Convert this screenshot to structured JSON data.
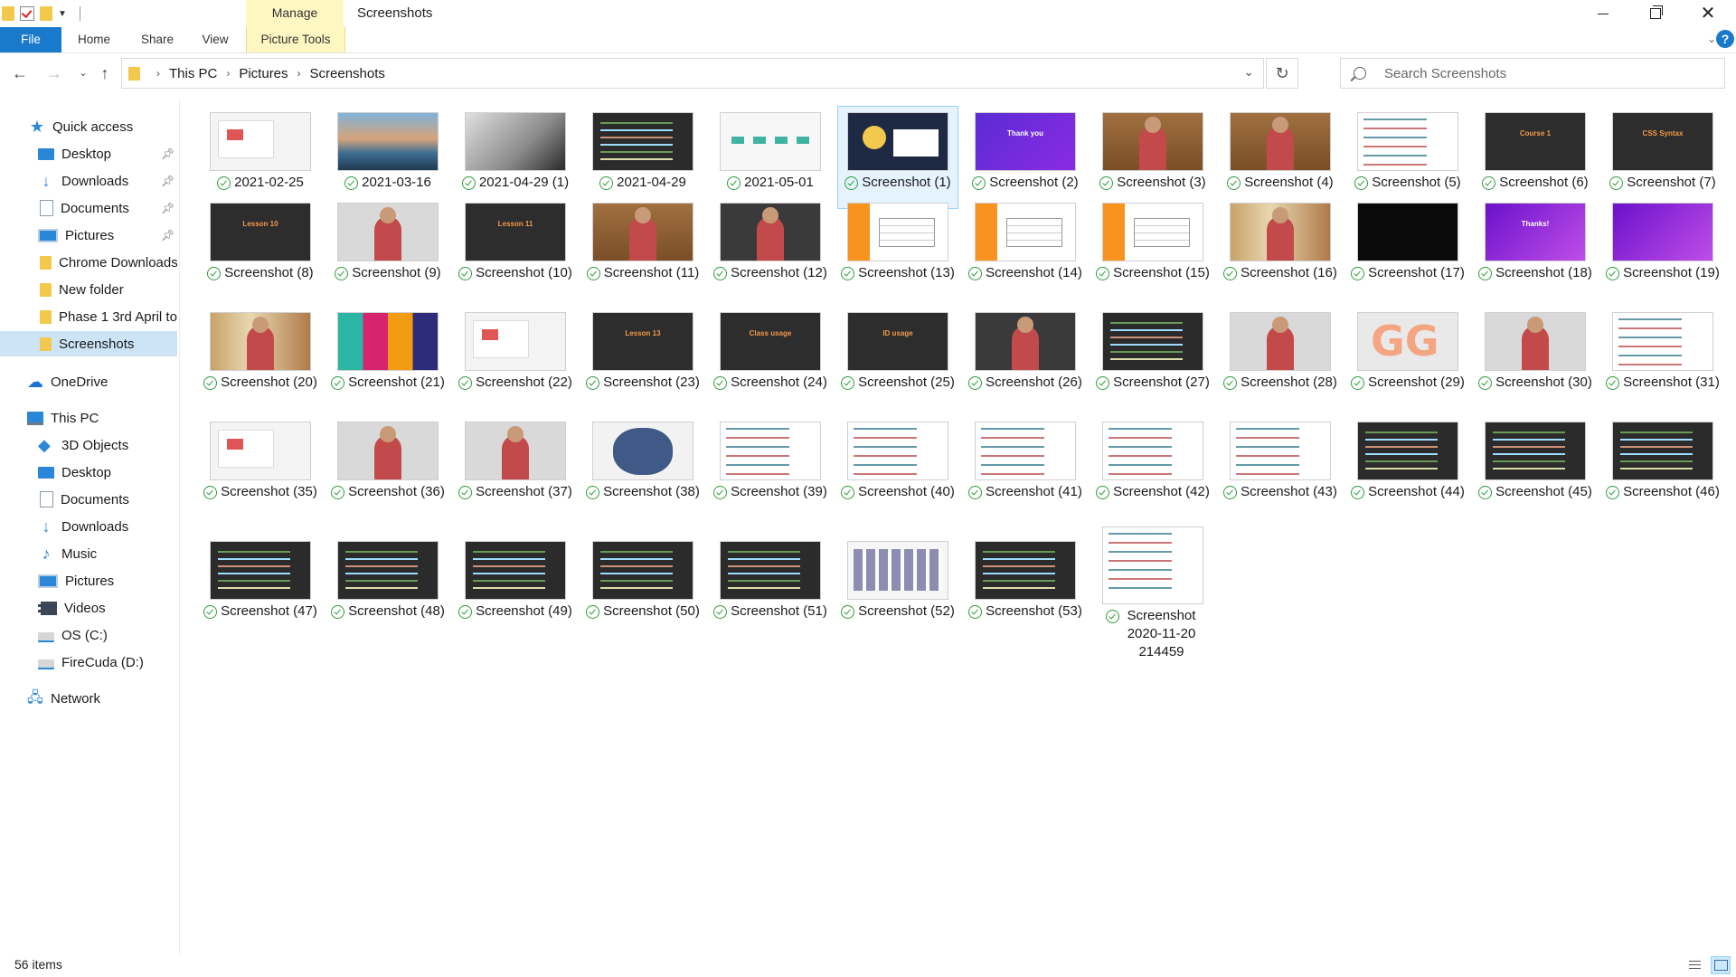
{
  "window": {
    "title": "Screenshots",
    "context_tab": "Manage"
  },
  "ribbon": {
    "tabs": [
      "File",
      "Home",
      "Share",
      "View"
    ],
    "context_label": "Picture Tools",
    "help_label": "?"
  },
  "address": {
    "crumbs": [
      "This PC",
      "Pictures",
      "Screenshots"
    ]
  },
  "search": {
    "placeholder": "Search Screenshots"
  },
  "sidebar": {
    "quick_access": "Quick access",
    "quick_items": [
      "Desktop",
      "Downloads",
      "Documents",
      "Pictures",
      "Chrome Downloads",
      "New folder",
      "Phase 1 3rd April to",
      "Screenshots"
    ],
    "onedrive": "OneDrive",
    "this_pc": "This PC",
    "pc_items": [
      "3D Objects",
      "Desktop",
      "Documents",
      "Downloads",
      "Music",
      "Pictures",
      "Videos",
      "OS (C:)",
      "FireCuda (D:)"
    ],
    "network": "Network"
  },
  "files": [
    {
      "name": "2021-02-25",
      "theme": "t-light"
    },
    {
      "name": "2021-03-16",
      "theme": "t-ocean"
    },
    {
      "name": "2021-04-29 (1)",
      "theme": "t-gray"
    },
    {
      "name": "2021-04-29",
      "theme": "t-code"
    },
    {
      "name": "2021-05-01",
      "theme": "t-flow"
    },
    {
      "name": "Screenshot (1)",
      "theme": "t-navy"
    },
    {
      "name": "Screenshot (2)",
      "theme": "t-purple",
      "slide": "Thank you"
    },
    {
      "name": "Screenshot (3)",
      "theme": "t-wood"
    },
    {
      "name": "Screenshot (4)",
      "theme": "t-wood"
    },
    {
      "name": "Screenshot (5)",
      "theme": "t-snip"
    },
    {
      "name": "Screenshot (6)",
      "theme": "t-darkslide",
      "slide": "Course 1"
    },
    {
      "name": "Screenshot (7)",
      "theme": "t-darkslide",
      "slide": "CSS Syntax"
    },
    {
      "name": "Screenshot (8)",
      "theme": "t-darkslide",
      "slide": "Lesson 10"
    },
    {
      "name": "Screenshot (9)",
      "theme": "t-room"
    },
    {
      "name": "Screenshot (10)",
      "theme": "t-darkslide",
      "slide": "Lesson 11"
    },
    {
      "name": "Screenshot (11)",
      "theme": "t-wood"
    },
    {
      "name": "Screenshot (12)",
      "theme": "t-studio"
    },
    {
      "name": "Screenshot (13)",
      "theme": "t-orange"
    },
    {
      "name": "Screenshot (14)",
      "theme": "t-orange"
    },
    {
      "name": "Screenshot (15)",
      "theme": "t-orange"
    },
    {
      "name": "Screenshot (16)",
      "theme": "t-books"
    },
    {
      "name": "Screenshot (17)",
      "theme": "t-black"
    },
    {
      "name": "Screenshot (18)",
      "theme": "t-purple2",
      "slide": "Thanks!"
    },
    {
      "name": "Screenshot (19)",
      "theme": "t-purple2"
    },
    {
      "name": "Screenshot (20)",
      "theme": "t-books"
    },
    {
      "name": "Screenshot (21)",
      "theme": "t-stripes"
    },
    {
      "name": "Screenshot (22)",
      "theme": "t-light"
    },
    {
      "name": "Screenshot (23)",
      "theme": "t-darkslide",
      "slide": "Lesson 13"
    },
    {
      "name": "Screenshot (24)",
      "theme": "t-darkslide",
      "slide": "Class usage"
    },
    {
      "name": "Screenshot (25)",
      "theme": "t-darkslide",
      "slide": "ID usage"
    },
    {
      "name": "Screenshot (26)",
      "theme": "t-studio"
    },
    {
      "name": "Screenshot (27)",
      "theme": "t-code"
    },
    {
      "name": "Screenshot (28)",
      "theme": "t-room"
    },
    {
      "name": "Screenshot (29)",
      "theme": "t-logo"
    },
    {
      "name": "Screenshot (30)",
      "theme": "t-room"
    },
    {
      "name": "Screenshot (31)",
      "theme": "t-snip"
    },
    {
      "name": "Screenshot (35)",
      "theme": "t-light"
    },
    {
      "name": "Screenshot (36)",
      "theme": "t-room"
    },
    {
      "name": "Screenshot (37)",
      "theme": "t-room"
    },
    {
      "name": "Screenshot (38)",
      "theme": "t-brush"
    },
    {
      "name": "Screenshot (39)",
      "theme": "t-snip"
    },
    {
      "name": "Screenshot (40)",
      "theme": "t-snip"
    },
    {
      "name": "Screenshot (41)",
      "theme": "t-snip"
    },
    {
      "name": "Screenshot (42)",
      "theme": "t-snip"
    },
    {
      "name": "Screenshot (43)",
      "theme": "t-snip"
    },
    {
      "name": "Screenshot (44)",
      "theme": "t-code"
    },
    {
      "name": "Screenshot (45)",
      "theme": "t-code"
    },
    {
      "name": "Screenshot (46)",
      "theme": "t-code"
    },
    {
      "name": "Screenshot (47)",
      "theme": "t-code"
    },
    {
      "name": "Screenshot (48)",
      "theme": "t-code"
    },
    {
      "name": "Screenshot (49)",
      "theme": "t-code"
    },
    {
      "name": "Screenshot (50)",
      "theme": "t-code"
    },
    {
      "name": "Screenshot (51)",
      "theme": "t-code"
    },
    {
      "name": "Screenshot (52)",
      "theme": "t-grid"
    },
    {
      "name": "Screenshot (53)",
      "theme": "t-code"
    },
    {
      "name": "Screenshot 2020-11-20 214459",
      "theme": "t-snip",
      "tall": true
    }
  ],
  "selected_file": "Screenshot (1)",
  "status": {
    "item_count": "56 items"
  },
  "colors": {
    "accent": "#1979ca",
    "selection": "#cde4f7",
    "context_tab": "#fff7c2",
    "sync_ok": "#2e9d3a"
  }
}
